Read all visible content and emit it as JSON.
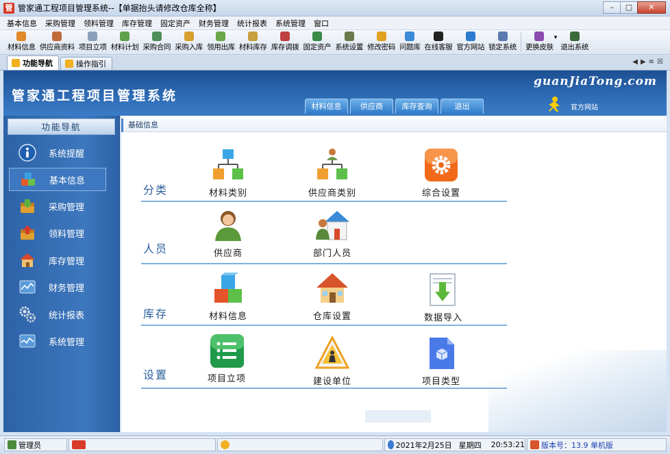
{
  "window": {
    "title": "管家通工程项目管理系统--【单据抬头请修改仓库全称】",
    "logo_char": "管"
  },
  "menubar": [
    "基本信息",
    "采购管理",
    "领料管理",
    "库存管理",
    "固定资产",
    "财务管理",
    "统计报表",
    "系统管理",
    "窗口"
  ],
  "toolbar": [
    {
      "label": "材料信息",
      "icon": "materials-icon",
      "color": "#e08a2a"
    },
    {
      "label": "供应商资料",
      "icon": "supplier-icon",
      "color": "#c06a3a"
    },
    {
      "label": "项目立项",
      "icon": "project-icon",
      "color": "#8aa0b8"
    },
    {
      "label": "材料计划",
      "icon": "plan-icon",
      "color": "#5fa04a"
    },
    {
      "label": "采购合同",
      "icon": "contract-icon",
      "color": "#4f8f5a"
    },
    {
      "label": "采购入库",
      "icon": "purchase-in-icon",
      "color": "#d8a030"
    },
    {
      "label": "领用出库",
      "icon": "issue-out-icon",
      "color": "#6aa84a"
    },
    {
      "label": "材料库存",
      "icon": "stock-icon",
      "color": "#c8a040"
    },
    {
      "label": "库存调拨",
      "icon": "transfer-icon",
      "color": "#c04040"
    },
    {
      "label": "固定资产",
      "icon": "fixed-asset-icon",
      "color": "#3a8a4a"
    },
    {
      "label": "系统设置",
      "icon": "settings-icon",
      "color": "#6a7a4a"
    },
    {
      "label": "修改密码",
      "icon": "password-icon",
      "color": "#e0a020"
    },
    {
      "label": "问题库",
      "icon": "question-icon",
      "color": "#3a8ad8"
    },
    {
      "label": "在线客服",
      "icon": "service-icon",
      "color": "#222222"
    },
    {
      "label": "官方网站",
      "icon": "website-icon",
      "color": "#2a7ad0"
    },
    {
      "label": "锁定系统",
      "icon": "lock-icon",
      "color": "#5a7ab0"
    },
    {
      "label": "更换皮肤",
      "icon": "skin-icon",
      "color": "#8a4ab0"
    },
    {
      "label": "退出系统",
      "icon": "exit-icon",
      "color": "#3a6a3a"
    }
  ],
  "tabs": [
    {
      "label": "功能导航",
      "active": true
    },
    {
      "label": "操作指引",
      "active": false
    }
  ],
  "banner": {
    "title": "管家通工程项目管理系统",
    "brand": "guanJiaTong.com",
    "tabs": [
      "材料信息",
      "供应商",
      "库存查询",
      "退出"
    ],
    "site_label": "官方网站"
  },
  "sidebar": {
    "header": "功能导航",
    "items": [
      {
        "label": "系统提醒",
        "icon": "info-icon"
      },
      {
        "label": "基本信息",
        "icon": "cubes-icon",
        "active": true
      },
      {
        "label": "采购管理",
        "icon": "purchase-icon"
      },
      {
        "label": "领料管理",
        "icon": "issue-icon"
      },
      {
        "label": "库存管理",
        "icon": "warehouse-icon"
      },
      {
        "label": "财务管理",
        "icon": "finance-icon"
      },
      {
        "label": "统计报表",
        "icon": "gears-icon"
      },
      {
        "label": "系统管理",
        "icon": "chart-icon"
      }
    ]
  },
  "main": {
    "breadcrumb": "基础信息",
    "sections": [
      {
        "label": "分类",
        "tiles": [
          {
            "label": "材料类别",
            "icon": "category-tree-icon"
          },
          {
            "label": "供应商类别",
            "icon": "supplier-tree-icon"
          },
          {
            "label": "综合设置",
            "icon": "gear-tile-icon"
          }
        ]
      },
      {
        "label": "人员",
        "tiles": [
          {
            "label": "供应商",
            "icon": "person-icon"
          },
          {
            "label": "部门人员",
            "icon": "department-icon"
          }
        ]
      },
      {
        "label": "库存",
        "tiles": [
          {
            "label": "材料信息",
            "icon": "cubes-tile-icon"
          },
          {
            "label": "仓库设置",
            "icon": "house-icon"
          },
          {
            "label": "数据导入",
            "icon": "import-icon"
          }
        ]
      },
      {
        "label": "设置",
        "tiles": [
          {
            "label": "项目立项",
            "icon": "list-icon"
          },
          {
            "label": "建设单位",
            "icon": "construction-icon"
          },
          {
            "label": "项目类型",
            "icon": "doc-cube-icon"
          }
        ]
      }
    ]
  },
  "status": {
    "user": "管理员",
    "date": "2021年2月25日",
    "weekday": "星期四",
    "time": "20:53:21",
    "version": "版本号：13.9 单机版"
  }
}
